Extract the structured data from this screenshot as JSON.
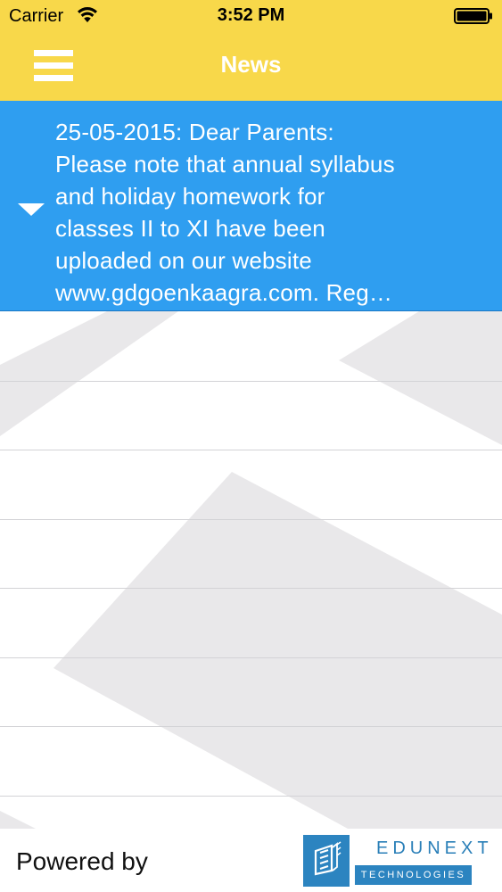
{
  "status_bar": {
    "carrier": "Carrier",
    "time": "3:52 PM",
    "wifi_icon": "wifi-icon",
    "battery_icon": "battery-icon"
  },
  "nav": {
    "title": "News",
    "menu_icon": "hamburger-menu-icon"
  },
  "news": [
    {
      "lines": [
        "25-05-2015: Dear Parents:",
        "Please note that annual syllabus",
        "and holiday homework for",
        "classes II to XI have been",
        "uploaded on our website",
        "www.gdgoenkaagra.com. Reg…"
      ],
      "expand_icon": "caret-down-icon"
    }
  ],
  "footer": {
    "powered_by": "Powered by",
    "logo_name": "EDUNEXT",
    "logo_tagline": "TECHNOLOGIES"
  },
  "colors": {
    "header": "#f8d84a",
    "news_row": "#2f9ef0",
    "logo_blue": "#2c84c0",
    "separator": "#d3d3d6"
  }
}
